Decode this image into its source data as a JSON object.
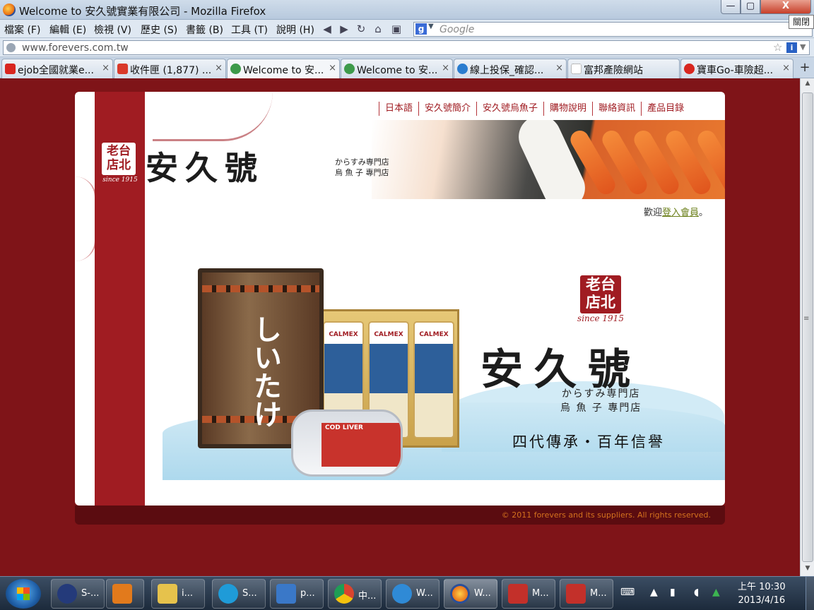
{
  "window": {
    "title": "Welcome to 安久號實業有限公司 - Mozilla Firefox",
    "minimize": "—",
    "maximize": "▢",
    "close": "X",
    "close_tooltip": "關閉"
  },
  "menu": [
    "檔案 (F)",
    "編輯 (E)",
    "檢視 (V)",
    "歷史 (S)",
    "書籤 (B)",
    "工具 (T)",
    "說明 (H)"
  ],
  "nav_icons": [
    "back-icon",
    "forward-icon",
    "reload-icon",
    "home-icon",
    "bookmark-page-icon"
  ],
  "search": {
    "engine": "g",
    "placeholder": "Google"
  },
  "url": "www.forevers.com.tw",
  "tabs": [
    {
      "label": "ejob全國就業e...",
      "fav": "#d8261f",
      "active": false
    },
    {
      "label": "收件匣 (1,877) ...",
      "fav": "#d93a2a",
      "active": false
    },
    {
      "label": "Welcome to 安...",
      "fav": "#3d9a4a",
      "active": true
    },
    {
      "label": "Welcome to 安...",
      "fav": "#3d9a4a",
      "active": false
    },
    {
      "label": "線上投保_確認...",
      "fav": "#2a7ccf",
      "active": false
    },
    {
      "label": "富邦產險網站",
      "fav": "#ffffff",
      "active": false
    },
    {
      "label": "寶車Go-車險超...",
      "fav": "#d8261f",
      "active": false
    }
  ],
  "tab_close": "×",
  "new_tab": "+",
  "site": {
    "nav": [
      "日本語",
      "安久號簡介",
      "安久號烏魚子",
      "購物說明",
      "聯絡資訊",
      "產品目錄"
    ],
    "seal_text": "老台店北",
    "since": "since 1915",
    "brand": "安久號",
    "sub_jp": "からすみ専門店",
    "sub_zh": "烏 魚 子 專門店",
    "welcome_prefix": "歡迎",
    "welcome_link": "登入會員",
    "welcome_suffix": "。",
    "bag_text": "しいたけ",
    "can_labels": [
      "CALMEX",
      "CALMEX",
      "CALMEX"
    ],
    "tin_label": "COD LIVER",
    "slogan": "四代傳承・百年信譽",
    "copyright": "© 2011 forevers and its suppliers. All rights reserved."
  },
  "taskbar": {
    "items": [
      {
        "label": "S-...",
        "icon": "#243a7a"
      },
      {
        "label": "",
        "icon": "#e27a1c"
      },
      {
        "label": "i...",
        "icon": "#e6c24c"
      },
      {
        "label": "S...",
        "icon": "#1f9bd8"
      },
      {
        "label": "p...",
        "icon": "#3a78c8"
      },
      {
        "label": "中...",
        "icon": "#d9442f"
      },
      {
        "label": "W...",
        "icon": "#2f8ad6"
      },
      {
        "label": "W...",
        "icon": "#e8741c",
        "active": true
      },
      {
        "label": "M...",
        "icon": "#c3302a"
      },
      {
        "label": "M...",
        "icon": "#c3302a"
      }
    ],
    "time": "上午 10:30",
    "date": "2013/4/16"
  },
  "colors": {
    "page_bg": "#7f1418",
    "brand_red": "#a01c22",
    "footer_text": "#d4721e"
  }
}
